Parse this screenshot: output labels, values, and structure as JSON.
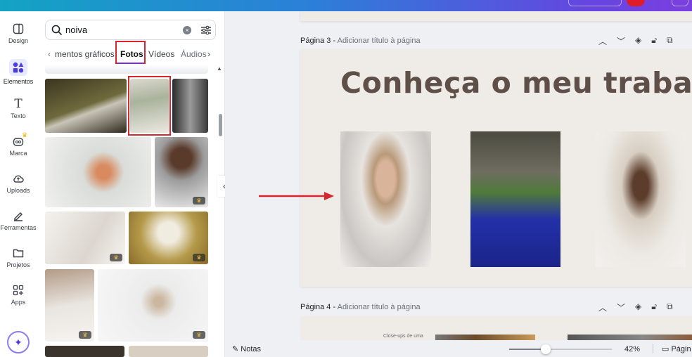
{
  "rail": {
    "items": [
      {
        "label": "Design"
      },
      {
        "label": "Elementos"
      },
      {
        "label": "Texto"
      },
      {
        "label": "Marca"
      },
      {
        "label": "Uploads"
      },
      {
        "label": "Ferramentas"
      },
      {
        "label": "Projetos"
      },
      {
        "label": "Apps"
      }
    ]
  },
  "panel": {
    "search_value": "noiva",
    "tabs": [
      "mentos gráficos",
      "Fotos",
      "Vídeos",
      "Áudios"
    ]
  },
  "canvas": {
    "page3": {
      "label": "Página 3",
      "sep": " - ",
      "subtitle": "Adicionar título à página",
      "title": "Conheça o meu trabalho"
    },
    "page4": {
      "label": "Página 4",
      "sep": " - ",
      "subtitle": "Adicionar título à página",
      "caption": "Close-ups de uma"
    }
  },
  "bottom": {
    "notes": "Notas",
    "zoom": "42%",
    "pages": "Págin",
    "zoom_level": 42
  },
  "colors": {
    "highlight": "#d7262f",
    "title": "#5f4f49",
    "page_bg": "#efebe6"
  }
}
